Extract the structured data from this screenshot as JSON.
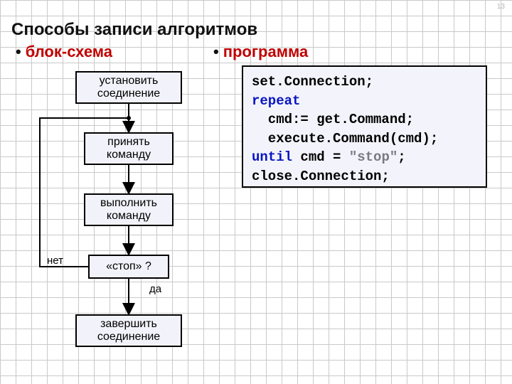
{
  "page_number": "13",
  "title": "Способы записи алгоритмов",
  "subtitles": {
    "flowchart": "блок-схема",
    "program": "программа"
  },
  "flow": {
    "b1": "установить\nсоединение",
    "b2": "принять\nкоманду",
    "b3": "выполнить\nкоманду",
    "b4": "«стоп» ?",
    "b5": "завершить\nсоединение",
    "no": "нет",
    "yes": "да"
  },
  "code": {
    "l1a": "set.Connection;",
    "l2k": "repeat",
    "l3a": "  cmd:= get.Command;",
    "l4a": "  execute.Command(cmd);",
    "l5k": "until",
    "l5a": " cmd = ",
    "l5s": "\"stop\"",
    "l5b": ";",
    "l6a": "close.Connection;"
  }
}
